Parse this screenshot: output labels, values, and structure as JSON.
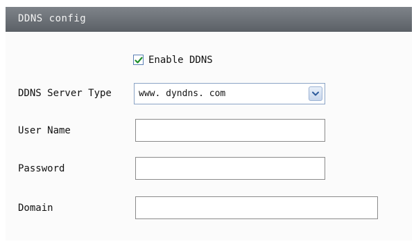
{
  "header": {
    "title": "DDNS config"
  },
  "enable_ddns": {
    "label": "Enable DDNS",
    "checked": true
  },
  "fields": {
    "server_type": {
      "label": "DDNS Server Type",
      "value": "www. dyndns. com"
    },
    "user_name": {
      "label": "User Name",
      "value": ""
    },
    "password": {
      "label": "Password",
      "value": ""
    },
    "domain": {
      "label": "Domain",
      "value": ""
    }
  },
  "colors": {
    "titlebar": "#6a6f75",
    "checkmark": "#1f8f2a"
  },
  "icons": {
    "dropdown": "chevron-down-icon",
    "check": "checkmark-icon"
  }
}
